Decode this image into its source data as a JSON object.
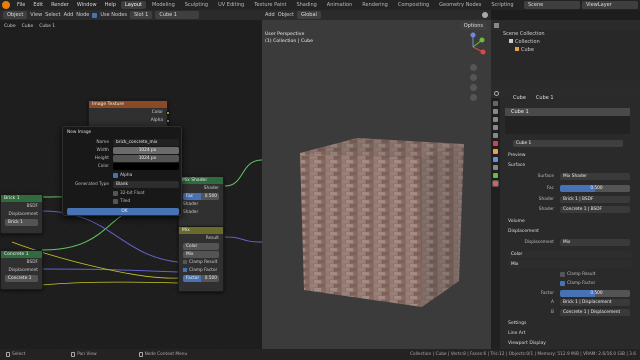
{
  "topbar": {
    "menus": [
      "File",
      "Edit",
      "Render",
      "Window",
      "Help"
    ],
    "tabs": [
      "Layout",
      "Modeling",
      "Sculpting",
      "UV Editing",
      "Texture Paint",
      "Shading",
      "Animation",
      "Rendering",
      "Compositing",
      "Geometry Nodes",
      "Scripting"
    ],
    "active_tab": "Layout",
    "scene_label": "Scene",
    "viewlayer_label": "ViewLayer"
  },
  "node_header": {
    "editor_type": "Object",
    "menus": [
      "View",
      "Select",
      "Add",
      "Node"
    ],
    "use_nodes": "Use Nodes",
    "slot": "Slot 1",
    "material": "Cube 1",
    "breadcrumb": [
      "Cube",
      "Cube",
      "Cube 1"
    ]
  },
  "viewport_header": {
    "menus": [
      "Add",
      "Object"
    ],
    "orientation": "Global",
    "options": "Options",
    "perspective": "User Perspective",
    "collection": "(1) Collection | Cube"
  },
  "image_texture_node": {
    "title": "Image Texture",
    "outputs": [
      "Color",
      "Alpha"
    ]
  },
  "new_image_popup": {
    "title": "New Image",
    "name_label": "Name",
    "name_value": "brick_concrete_mix",
    "width_label": "Width",
    "width_value": "1024 px",
    "height_label": "Height",
    "height_value": "1024 px",
    "color_label": "Color",
    "alpha_label": "Alpha",
    "generated_type_label": "Generated Type",
    "generated_type_value": "Blank",
    "float_label": "32-bit Float",
    "tiled_label": "Tiled",
    "ok_label": "OK"
  },
  "brick_node": {
    "title": "Brick 1",
    "output": "BSDF",
    "displacement": "Displacement",
    "input": "Brick 1"
  },
  "concrete_node": {
    "title": "Concrete 1",
    "output": "BSDF",
    "displacement": "Displacement",
    "input": "Concrete 1"
  },
  "mix_shader_node": {
    "title": "Mix Shader",
    "output": "Shader",
    "fac_label": "Fac",
    "fac_value": "0.500",
    "shader1": "Shader",
    "shader2": "Shader"
  },
  "mix_node": {
    "title": "Mix",
    "result": "Result",
    "data_type": "Color",
    "blend": "Mix",
    "clamp_result": "Clamp Result",
    "clamp_factor": "Clamp Factor",
    "factor_label": "Factor",
    "factor_value": "0.500",
    "a": "A",
    "b": "B"
  },
  "outliner": {
    "title": "Scene Collection",
    "items": [
      "Collection",
      "Cube"
    ]
  },
  "properties": {
    "breadcrumb": [
      "Cube",
      "Cube 1"
    ],
    "material_slot": "Cube 1",
    "material_name": "Cube 1",
    "sections": {
      "preview": "Preview",
      "surface": "Surface",
      "volume": "Volume",
      "displacement": "Displacement",
      "settings": "Settings",
      "line_art": "Line Art",
      "viewport_display": "Viewport Display"
    },
    "surface_label": "Surface",
    "surface_value": "Mix Shader",
    "fac_label": "Fac",
    "fac_value": "0.500",
    "shader1_label": "Shader",
    "shader1_value": "Brick 1 | BSDF",
    "shader2_label": "Shader",
    "shader2_value": "Concrete 1 | BSDF",
    "displacement_label": "Displacement",
    "displacement_value": "Mix",
    "color_dropdown": "Color",
    "mix_dropdown": "Mix",
    "clamp_result": "Clamp Result",
    "clamp_factor": "Clamp Factor",
    "factor_label": "Factor",
    "factor_value": "0.500",
    "a_label": "A",
    "a_value": "Brick 1 | Displacement",
    "b_label": "B",
    "b_value": "Concrete 1 | Displacement"
  },
  "statusbar": {
    "select": "Select",
    "pan": "Pan View",
    "context": "Node Context Menu",
    "stats": "Collection | Cube | Verts:8 | Faces:6 | Tris:12 | Objects:0/1 | Memory: 512.9 MiB | VRAM: 2.6/16.0 GiB | 3.6"
  },
  "colors": {
    "accent": "#4772b3",
    "brand": "#e87d0d",
    "shader_socket": "#63c763",
    "color_socket": "#c7c729",
    "vector_socket": "#6363c7"
  }
}
